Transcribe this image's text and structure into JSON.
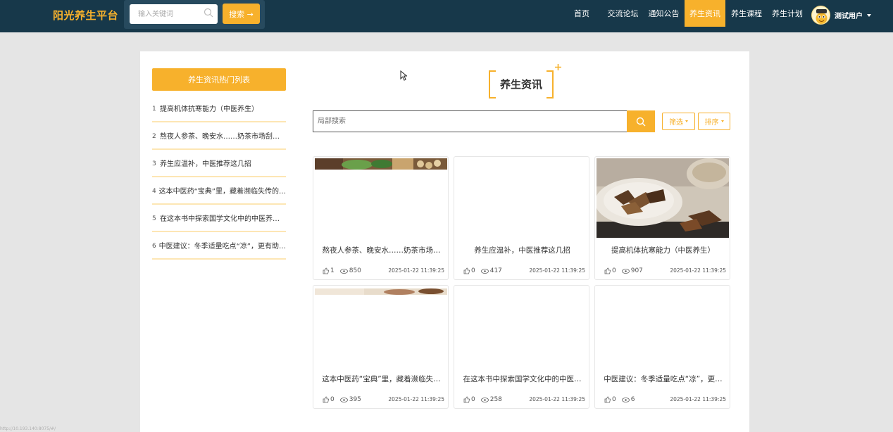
{
  "header": {
    "logo": "阳光养生平台",
    "search_placeholder": "输入关键词",
    "search_button": "搜索 →",
    "nav": [
      "首页",
      "交流论坛",
      "通知公告",
      "养生资讯",
      "养生课程",
      "养生计划"
    ],
    "active_nav": "养生资讯",
    "user_name": "测试用户"
  },
  "sidebar": {
    "title": "养生资讯热门列表",
    "items": [
      {
        "num": "1",
        "label": "提高机体抗寒能力（中医养生）"
      },
      {
        "num": "2",
        "label": "熬夜人参茶、晚安水……奶茶市场刮…"
      },
      {
        "num": "3",
        "label": "养生应温补，中医推荐这几招"
      },
      {
        "num": "4",
        "label": "这本中医药“宝典”里，藏着濒临失传的…"
      },
      {
        "num": "5",
        "label": "在这本书中探索国学文化中的中医养…"
      },
      {
        "num": "6",
        "label": "中医建议：冬季适量吃点“凉”，更有助…"
      }
    ]
  },
  "main": {
    "title": "养生资讯",
    "search_placeholder": "局部搜索",
    "filter_label": "筛选",
    "sort_label": "排序"
  },
  "cards": [
    {
      "title": "熬夜人参茶、晚安水……奶茶市场…",
      "likes": "1",
      "views": "850",
      "date": "2025-01-22 11:39:25",
      "image": "herbs-strip-top"
    },
    {
      "title": "养生应温补，中医推荐这几招",
      "likes": "0",
      "views": "417",
      "date": "2025-01-22 11:39:25",
      "image": "none"
    },
    {
      "title": "提高机体抗寒能力（中医养生）",
      "likes": "0",
      "views": "907",
      "date": "2025-01-22 11:39:25",
      "image": "dried-herbs-plate"
    },
    {
      "title": "这本中医药“宝典”里，藏着濒临失…",
      "likes": "0",
      "views": "395",
      "date": "2025-01-22 11:39:25",
      "image": "herbs-strip-top-2"
    },
    {
      "title": "在这本书中探索国学文化中的中医…",
      "likes": "0",
      "views": "258",
      "date": "2025-01-22 11:39:25",
      "image": "none"
    },
    {
      "title": "中医建议：冬季适量吃点“凉”，更…",
      "likes": "0",
      "views": "6",
      "date": "2025-01-22 11:39:25",
      "image": "none"
    }
  ],
  "status_bar_url": "http://10.193.140:8075/#/",
  "colors": {
    "accent": "#f7b12c",
    "topbar": "#17384a",
    "page_bg": "#e5e5e5"
  }
}
